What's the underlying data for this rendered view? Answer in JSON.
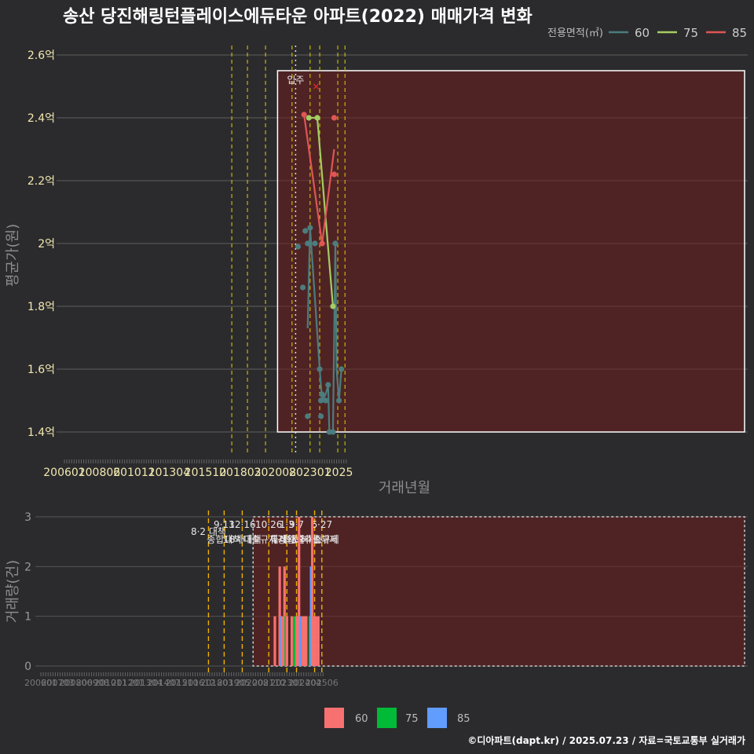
{
  "title": "송산 당진해링턴플레이스에듀타운 아파트(2022) 매매가격 변화",
  "credit": "©디아파트(dapt.kr) / 2025.07.23 / 자료=국토교통부 실거래가",
  "colors": {
    "60": "#4b7d7e",
    "75": "#a5cd63",
    "85": "#e05555",
    "bar60": "#f87171",
    "bar75": "#00ba38",
    "bar85": "#619cff"
  },
  "chart_data": [
    {
      "type": "line",
      "title": "송산 당진해링턴플레이스에듀타운 아파트(2022) 매매가격 변화",
      "xlabel": "거래년월",
      "ylabel": "평균가(원)",
      "x_ticks": [
        "200601",
        "200806",
        "201011",
        "201304",
        "201510",
        "201803",
        "202008",
        "202301",
        "2025"
      ],
      "y_ticks": [
        {
          "v": 1.4,
          "label": "1.4억"
        },
        {
          "v": 1.6,
          "label": "1.6억"
        },
        {
          "v": 1.8,
          "label": "1.8억"
        },
        {
          "v": 2.0,
          "label": "2억"
        },
        {
          "v": 2.2,
          "label": "2.2억"
        },
        {
          "v": 2.4,
          "label": "2.4억"
        },
        {
          "v": 2.6,
          "label": "2.6억"
        }
      ],
      "ylim": [
        1.33,
        2.63
      ],
      "legend": {
        "title": "전용면적(㎡)",
        "entries": [
          "60",
          "75",
          "85"
        ],
        "position": "top-right"
      },
      "policy_lines": [
        "2017-08",
        "2018-09",
        "2019-12",
        "2021-10",
        "2023-01",
        "2023-09",
        "2024-12",
        "2025-06"
      ],
      "move_in": {
        "date": "2022-01",
        "label": "입주"
      },
      "series": [
        {
          "name": "60",
          "points": [
            [
              "2022-03",
              1.99
            ],
            [
              "2022-07",
              1.86
            ],
            [
              "2022-09",
              2.04
            ],
            [
              "2022-11",
              2.0
            ],
            [
              "2022-11",
              1.45
            ],
            [
              "2023-01",
              2.05
            ],
            [
              "2023-05",
              2.0
            ],
            [
              "2023-09",
              1.6
            ],
            [
              "2023-10",
              1.45
            ],
            [
              "2023-10",
              1.5
            ],
            [
              "2023-11",
              1.52
            ],
            [
              "2024-02",
              1.5
            ],
            [
              "2024-04",
              1.55
            ],
            [
              "2024-05",
              1.4
            ],
            [
              "2024-08",
              1.4
            ],
            [
              "2024-10",
              2.0
            ],
            [
              "2025-01",
              1.5
            ],
            [
              "2025-03",
              1.6
            ]
          ],
          "line": [
            [
              "2022-11",
              1.73
            ],
            [
              "2023-01",
              2.05
            ],
            [
              "2023-09",
              1.6
            ],
            [
              "2023-11",
              1.5
            ],
            [
              "2024-02",
              1.52
            ],
            [
              "2024-04",
              1.55
            ],
            [
              "2024-05",
              1.4
            ],
            [
              "2024-08",
              1.4
            ],
            [
              "2024-10",
              2.0
            ],
            [
              "2024-11",
              1.6
            ],
            [
              "2025-01",
              1.5
            ],
            [
              "2025-03",
              1.6
            ]
          ]
        },
        {
          "name": "75",
          "points": [
            [
              "2022-12",
              2.4
            ],
            [
              "2023-07",
              2.4
            ],
            [
              "2024-08",
              1.8
            ]
          ],
          "line": [
            [
              "2022-12",
              2.4
            ],
            [
              "2023-07",
              2.4
            ],
            [
              "2024-08",
              1.8
            ]
          ]
        },
        {
          "name": "85",
          "points": [
            [
              "2022-08",
              2.41
            ],
            [
              "2023-11",
              2.0
            ],
            [
              "2024-09",
              2.22
            ],
            [
              "2024-09",
              2.4
            ]
          ],
          "line": [
            [
              "2022-08",
              2.41
            ],
            [
              "2023-11",
              2.0
            ],
            [
              "2024-09",
              2.3
            ]
          ],
          "x_marker": [
            "2023-06",
            2.5
          ]
        }
      ]
    },
    {
      "type": "bar",
      "ylabel": "거래량(건)",
      "x_ticks": [
        "200601",
        "200703",
        "200806",
        "200908",
        "201011",
        "201201",
        "201304",
        "201407",
        "201510",
        "201612",
        "201803",
        "201905",
        "202008",
        "202110",
        "202301",
        "202404",
        "202506"
      ],
      "ylim": [
        0,
        3
      ],
      "y_ticks": [
        0,
        1,
        2,
        3
      ],
      "legend": [
        "60",
        "75",
        "85"
      ],
      "policy": [
        {
          "date": "2017-08",
          "l1": "8·2 대책",
          "l2": ""
        },
        {
          "date": "2018-09",
          "l1": "9·13",
          "l2": "종합대책"
        },
        {
          "date": "2019-12",
          "l1": "12·16",
          "l2": "18차대책"
        },
        {
          "date": "2021-10",
          "l1": "10·26",
          "l2": "대출규제강화"
        },
        {
          "date": "2023-01",
          "l1": "1·3",
          "l2": "규제완화"
        },
        {
          "date": "2023-09",
          "l1": "9·7",
          "l2": "특례대출축소"
        },
        {
          "date": "2024-12",
          "l1": "",
          "l2": "토허제 해제"
        },
        {
          "date": "2025-06",
          "l1": "6·27",
          "l2": "대출규제"
        }
      ],
      "bars": [
        {
          "date": "2022-03",
          "s": "60",
          "v": 1
        },
        {
          "date": "2022-07",
          "s": "60",
          "v": 2
        },
        {
          "date": "2022-08",
          "s": "85",
          "v": 1
        },
        {
          "date": "2022-09",
          "s": "60",
          "v": 1
        },
        {
          "date": "2022-11",
          "s": "60",
          "v": 2
        },
        {
          "date": "2022-12",
          "s": "75",
          "v": 1
        },
        {
          "date": "2023-01",
          "s": "60",
          "v": 1
        },
        {
          "date": "2023-05",
          "s": "60",
          "v": 1
        },
        {
          "date": "2023-07",
          "s": "75",
          "v": 1
        },
        {
          "date": "2023-09",
          "s": "60",
          "v": 1
        },
        {
          "date": "2023-10",
          "s": "60",
          "v": 1
        },
        {
          "date": "2023-11",
          "s": "60",
          "v": 3
        },
        {
          "date": "2023-12",
          "s": "85",
          "v": 1
        },
        {
          "date": "2024-02",
          "s": "60",
          "v": 1
        },
        {
          "date": "2024-03",
          "s": "60",
          "v": 1
        },
        {
          "date": "2024-04",
          "s": "60",
          "v": 1
        },
        {
          "date": "2024-05",
          "s": "60",
          "v": 1
        },
        {
          "date": "2024-08",
          "s": "75",
          "v": 1
        },
        {
          "date": "2024-09",
          "s": "85",
          "v": 2
        },
        {
          "date": "2024-10",
          "s": "60",
          "v": 3
        },
        {
          "date": "2024-11",
          "s": "60",
          "v": 1
        },
        {
          "date": "2025-01",
          "s": "60",
          "v": 1
        },
        {
          "date": "2025-03",
          "s": "60",
          "v": 1
        }
      ]
    }
  ]
}
